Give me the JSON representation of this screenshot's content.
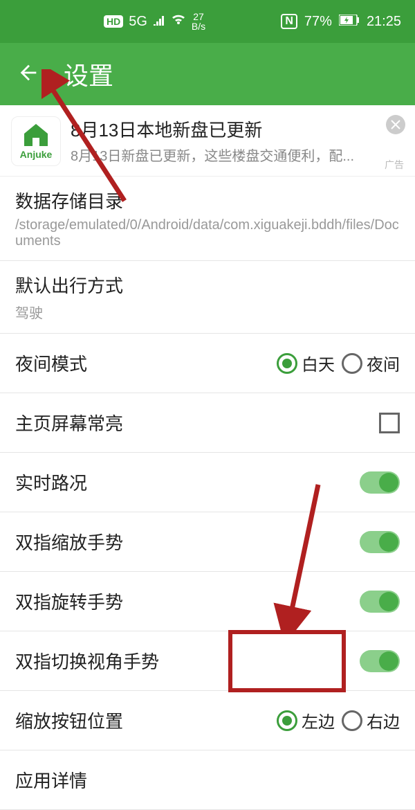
{
  "status": {
    "hd": "HD",
    "net": "5G",
    "speed_val": "27",
    "speed_unit": "B/s",
    "nfc": "N",
    "battery": "77%",
    "time": "21:25"
  },
  "header": {
    "title": "设置"
  },
  "ad": {
    "icon_label": "Anjuke",
    "title": "8月13日本地新盘已更新",
    "subtitle": "8月13日新盘已更新，这些楼盘交通便利，配...",
    "tag": "广告"
  },
  "rows": {
    "storage_label": "数据存储目录",
    "storage_path": "/storage/emulated/0/Android/data/com.xiguakeji.bddh/files/Documents",
    "travel_label": "默认出行方式",
    "travel_value": "驾驶",
    "night_label": "夜间模式",
    "night_opt1": "白天",
    "night_opt2": "夜间",
    "keepon_label": "主页屏幕常亮",
    "traffic_label": "实时路况",
    "pinch_label": "双指缩放手势",
    "rotate_label": "双指旋转手势",
    "tilt_label": "双指切换视角手势",
    "zoompos_label": "缩放按钮位置",
    "zoompos_opt1": "左边",
    "zoompos_opt2": "右边",
    "appdetail_label": "应用详情"
  }
}
